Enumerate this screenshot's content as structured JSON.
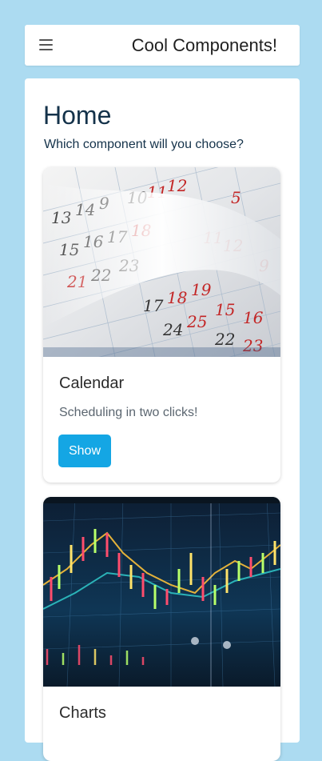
{
  "header": {
    "app_title": "Cool Components!"
  },
  "page": {
    "title": "Home",
    "subtitle": "Which component will you choose?"
  },
  "cards": [
    {
      "title": "Calendar",
      "description": "Scheduling in two clicks!",
      "button_label": "Show",
      "image_icon": "calendar-photo"
    },
    {
      "title": "Charts",
      "image_icon": "stock-chart-photo"
    }
  ],
  "colors": {
    "background": "#acdbf1",
    "primary_button": "#14a6e4",
    "heading": "#14324a"
  }
}
